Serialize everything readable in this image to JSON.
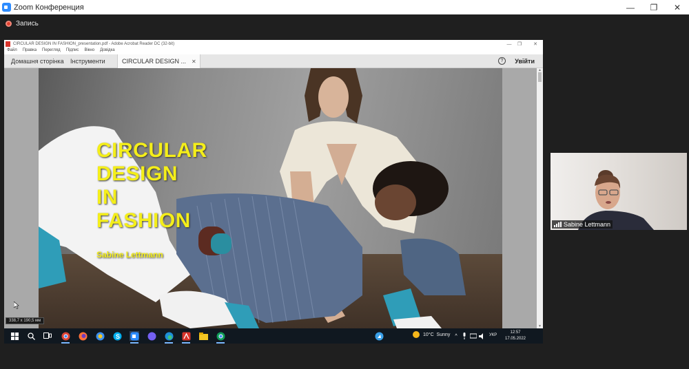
{
  "zoom": {
    "title": "Zoom Конференция",
    "recording_label": "Запись",
    "window_controls": [
      "—",
      "❐",
      "✕"
    ]
  },
  "acrobat": {
    "title": "CIRCULAR DESIGN IN FASHION_presentation.pdf - Adobe Acrobat Reader DC (32-bit)",
    "window_controls": [
      "—",
      "❐",
      "✕"
    ],
    "menu": [
      "Файл",
      "Правка",
      "Перегляд",
      "Підпис",
      "Вікно",
      "Довідка"
    ],
    "tabs": {
      "home": "Домашня сторінка",
      "tools": "Інструменти",
      "document": "CIRCULAR DESIGN ...",
      "close": "✕"
    },
    "help": "?",
    "sign_in": "Увійти",
    "page_size": "338,7 x 190,5 мм"
  },
  "slide": {
    "title_lines": [
      "CIRCULAR",
      "DESIGN",
      "IN",
      "FASHION"
    ],
    "author": "Sabine Lettmann"
  },
  "taskbar": {
    "weather_temp": "10°C",
    "weather_desc": "Sunny",
    "language": "УКР",
    "time": "12:57",
    "date": "17.05.2022"
  },
  "participant": {
    "name": "Sabine Lettmann"
  },
  "colors": {
    "slide_title": "#f4ee1a",
    "zoom_blue": "#2d8cff",
    "record_red": "#e3412f"
  }
}
